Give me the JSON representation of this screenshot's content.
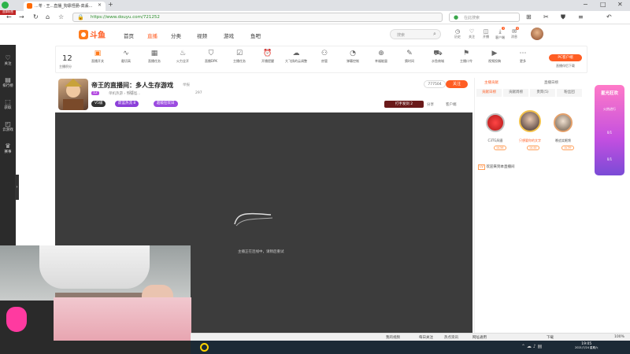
{
  "browser": {
    "tab_title": "...苓 · 王...直播_狗靠怪肠-高丢...",
    "url": "https://www.douyu.com/721252",
    "search_placeholder": "在此搜索",
    "label_badge": "选择标签"
  },
  "site": {
    "nav": [
      "首页",
      "直播",
      "分类",
      "视频",
      "游戏",
      "鱼吧"
    ],
    "search_placeholder": "搜索",
    "header_icons": [
      "历史",
      "关注",
      "开播",
      "客户端",
      "消息"
    ],
    "header_badges": [
      "1",
      "4"
    ]
  },
  "sidebar": [
    "关注",
    "排行榜",
    "获取",
    "云游戏",
    "赛事"
  ],
  "toolbar": {
    "date_day": "12",
    "date_label": "主播积分",
    "items": [
      "直播开关",
      "截切高",
      "直播任务",
      "火力全开",
      "直播DPK",
      "主播任务",
      "开播提醒",
      "大飞扬的云调整",
      "房管",
      "弹幕控制",
      "幸福能量",
      "猜时间",
      "水鱼商城",
      "主播口令",
      "视频投稿",
      "更多"
    ],
    "pc_button": "PC客户端",
    "pc_sub": "直播伴侣下载"
  },
  "room": {
    "title": "帝王的直播间：多人生存游戏",
    "report": "举报",
    "meta": "单机热游 › 熊猫怪...",
    "level": "12",
    "hot": "27",
    "follow_count": "297",
    "fans": "777504",
    "follow_label": "关注",
    "pills": [
      "V5级",
      "蔚蓝热流  8",
      "超级狂欢日"
    ],
    "actions": [
      "分享",
      "客户端"
    ]
  },
  "video": {
    "offline_text": "主播正在连线中，请稍后重试",
    "promo": "打手发剑  2"
  },
  "rank": {
    "tabs_top": [
      "主播贡献",
      "直播日榜"
    ],
    "tabs": [
      "贡献日榜",
      "贡献周榜",
      "贵宾(5)",
      "粉丝团"
    ],
    "users": [
      {
        "name": "C3TG风骚",
        "level": "LV.56"
      },
      {
        "name": "只想要你的文字",
        "level": "LV.44"
      },
      {
        "name": "晚追笑眠馋",
        "level": "LV.39"
      }
    ],
    "chat": "欢迎来到本直播间"
  },
  "promo": {
    "title": "星光狂欢",
    "lines": [
      "火热进行",
      "0/1",
      "0/1"
    ]
  },
  "status": [
    "我的视频",
    "每日关注",
    "热点资讯",
    "网址通用",
    "下载",
    "100%"
  ],
  "clock": {
    "time": "19:05",
    "date": "2021/7/24 星期六"
  }
}
